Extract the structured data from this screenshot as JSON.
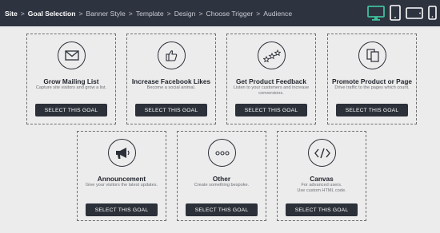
{
  "breadcrumb": {
    "items": [
      {
        "label": "Site",
        "bold": true
      },
      {
        "label": "Goal Selection",
        "bold": true
      },
      {
        "label": "Banner Style",
        "bold": false
      },
      {
        "label": "Template",
        "bold": false
      },
      {
        "label": "Design",
        "bold": false
      },
      {
        "label": "Choose Trigger",
        "bold": false
      },
      {
        "label": "Audience",
        "bold": false
      }
    ],
    "separator": ">"
  },
  "device_toggles": [
    {
      "icon": "desktop-icon",
      "active": true
    },
    {
      "icon": "tablet-portrait-icon",
      "active": false
    },
    {
      "icon": "tablet-landscape-icon",
      "active": false
    },
    {
      "icon": "mobile-icon",
      "active": false
    }
  ],
  "colors": {
    "topbar": "#2e3340",
    "active_device": "#3fbf9c",
    "button": "#2b3039",
    "background": "#ececec"
  },
  "goals": [
    {
      "title": "Grow Mailing List",
      "desc_line1": "Capture site visitors and grow a list.",
      "desc_line2": "",
      "button": "SELECT THIS GOAL",
      "icon": "envelope-icon"
    },
    {
      "title": "Increase Facebook Likes",
      "desc_line1": "Become a social animal.",
      "desc_line2": "",
      "button": "SELECT THIS GOAL",
      "icon": "thumbs-up-icon"
    },
    {
      "title": "Get Product Feedback",
      "desc_line1": "Listen to your customers and increase",
      "desc_line2": "conversions.",
      "button": "SELECT THIS GOAL",
      "icon": "stars-icon"
    },
    {
      "title": "Promote Product or Page",
      "desc_line1": "Drive traffic to the pages which count.",
      "desc_line2": "",
      "button": "SELECT THIS GOAL",
      "icon": "pages-icon"
    },
    {
      "title": "Announcement",
      "desc_line1": "Give your visitors the latest updates.",
      "desc_line2": "",
      "button": "SELECT THIS GOAL",
      "icon": "megaphone-icon"
    },
    {
      "title": "Other",
      "desc_line1": "Create something bespoke.",
      "desc_line2": "",
      "button": "SELECT THIS GOAL",
      "icon": "ellipsis-icon"
    },
    {
      "title": "Canvas",
      "desc_line1": "For advanced users.",
      "desc_line2": "Use custom HTML code.",
      "button": "SELECT THIS GOAL",
      "icon": "code-icon"
    }
  ]
}
